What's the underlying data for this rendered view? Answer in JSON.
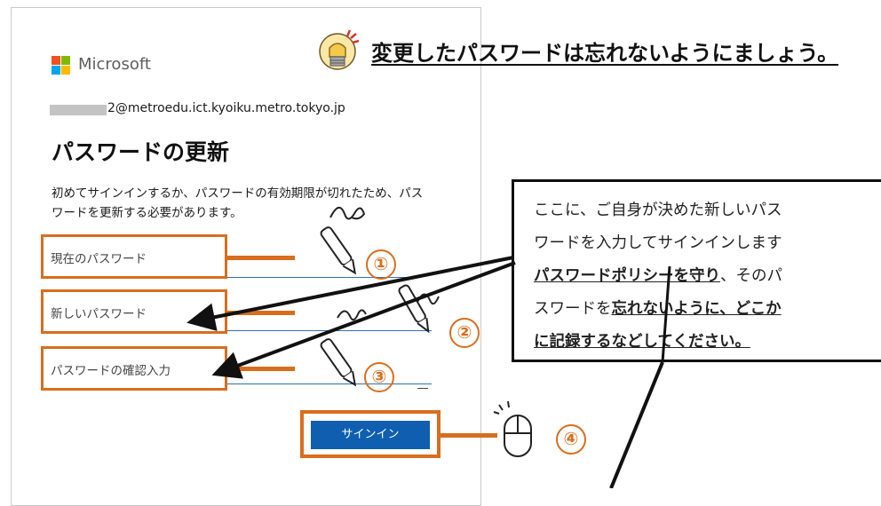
{
  "tip": {
    "text": "変更したパスワードは忘れないようにましょう。",
    "icon": "lightbulb-icon"
  },
  "signin": {
    "brand": "Microsoft",
    "email": "2@metroedu.ict.kyoiku.metro.tokyo.jp",
    "title": "パスワードの更新",
    "description": "初めてサインインするか、パスワードの有効期限が切れたため、パスワードを更新する必要があります。",
    "fields": [
      {
        "label": "現在のパスワード",
        "step": "①"
      },
      {
        "label": "新しいパスワード",
        "step": "②"
      },
      {
        "label": "パスワードの確認入力",
        "step": "③"
      }
    ],
    "button": {
      "label": "サインイン",
      "step": "④"
    }
  },
  "callout": {
    "text_1": "ここに、ご自身が決めた新しいパス",
    "text_2": "ワードを入力してサインインします",
    "text_3_underlined": "パスワードポリシーを守り",
    "text_3_rest": "、そのパ",
    "text_4_plain": "スワードを",
    "text_4_underlined": "忘れないように、どこか",
    "text_5_underlined": "に記録するなどしてください。"
  },
  "colors": {
    "highlight": "#d86e1e",
    "button": "#0f5eb0",
    "ms_red": "#f25022",
    "ms_green": "#7fba00",
    "ms_blue": "#00a4ef",
    "ms_yellow": "#ffb900"
  }
}
